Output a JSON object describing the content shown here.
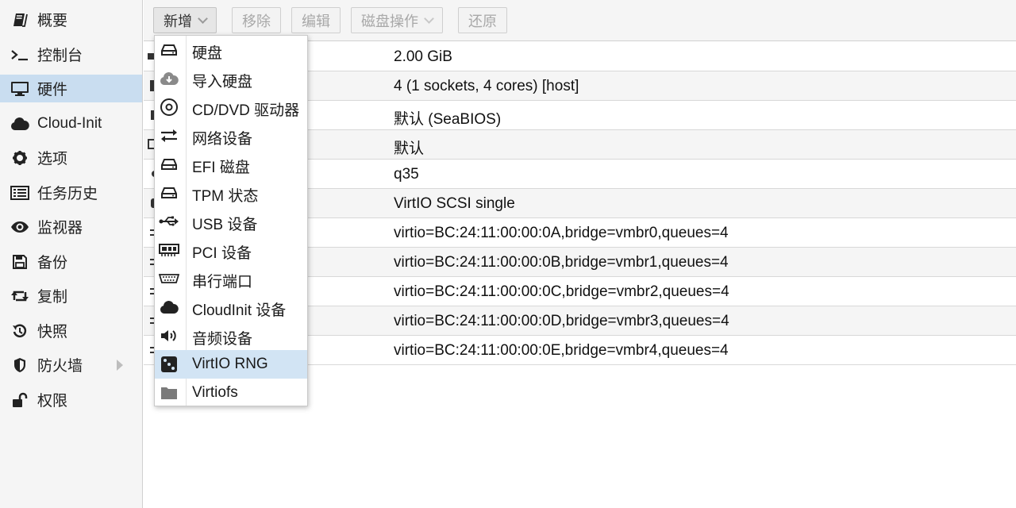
{
  "sidebar": {
    "items": [
      {
        "label": "概要",
        "icon": "book-icon"
      },
      {
        "label": "控制台",
        "icon": "terminal-icon"
      },
      {
        "label": "硬件",
        "icon": "monitor-icon",
        "active": true
      },
      {
        "label": "Cloud-Init",
        "icon": "cloud-icon"
      },
      {
        "label": "选项",
        "icon": "gear-icon"
      },
      {
        "label": "任务历史",
        "icon": "list-icon"
      },
      {
        "label": "监视器",
        "icon": "eye-icon"
      },
      {
        "label": "备份",
        "icon": "floppy-icon"
      },
      {
        "label": "复制",
        "icon": "retweet-icon"
      },
      {
        "label": "快照",
        "icon": "history-icon"
      },
      {
        "label": "防火墙",
        "icon": "shield-icon"
      },
      {
        "label": "权限",
        "icon": "unlock-icon"
      }
    ]
  },
  "toolbar": {
    "add_label": "新增",
    "remove_label": "移除",
    "edit_label": "编辑",
    "disk_action_label": "磁盘操作",
    "revert_label": "还原"
  },
  "table": {
    "rows": [
      "2.00 GiB",
      "4 (1 sockets, 4 cores) [host]",
      "默认 (SeaBIOS)",
      "默认",
      "q35",
      "VirtIO SCSI single",
      "virtio=BC:24:11:00:00:0A,bridge=vmbr0,queues=4",
      "virtio=BC:24:11:00:00:0B,bridge=vmbr1,queues=4",
      "virtio=BC:24:11:00:00:0C,bridge=vmbr2,queues=4",
      "virtio=BC:24:11:00:00:0D,bridge=vmbr3,queues=4",
      "virtio=BC:24:11:00:00:0E,bridge=vmbr4,queues=4"
    ]
  },
  "menu": {
    "items": [
      {
        "label": "硬盘",
        "icon": "hdd-icon"
      },
      {
        "label": "导入硬盘",
        "icon": "cloud-download-icon"
      },
      {
        "label": "CD/DVD 驱动器",
        "icon": "cdrom-icon"
      },
      {
        "label": "网络设备",
        "icon": "exchange-icon"
      },
      {
        "label": "EFI 磁盘",
        "icon": "hdd-icon"
      },
      {
        "label": "TPM 状态",
        "icon": "hdd-icon"
      },
      {
        "label": "USB 设备",
        "icon": "usb-icon"
      },
      {
        "label": "PCI 设备",
        "icon": "pci-card-icon"
      },
      {
        "label": "串行端口",
        "icon": "serial-port-icon"
      },
      {
        "label": "CloudInit 设备",
        "icon": "cloud-icon"
      },
      {
        "label": "音频设备",
        "icon": "volume-icon"
      },
      {
        "label": "VirtIO RNG",
        "icon": "dice-icon",
        "active": true
      },
      {
        "label": "Virtiofs",
        "icon": "folder-icon"
      }
    ]
  },
  "colors": {
    "active_nav": "#c9ddf0",
    "active_menu": "#d2e4f4",
    "sidebar_bg": "#f5f5f5"
  }
}
